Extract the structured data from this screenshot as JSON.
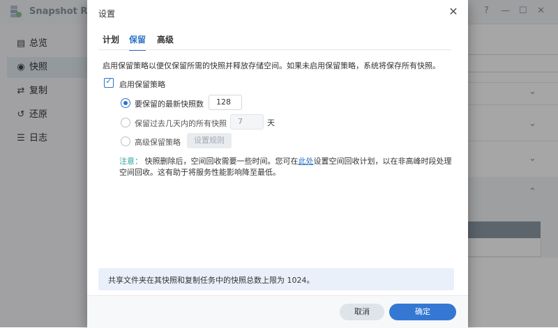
{
  "app": {
    "title": "Snapshot Replic",
    "window_controls": {
      "help": "?",
      "minimize": "—",
      "maximize": "☐",
      "close": "✕"
    }
  },
  "sidebar": {
    "items": [
      {
        "label": "总览",
        "icon": "overview-icon",
        "glyph": "▤"
      },
      {
        "label": "快照",
        "icon": "camera-icon",
        "glyph": "◉",
        "active": true
      },
      {
        "label": "复制",
        "icon": "replication-icon",
        "glyph": "⇄"
      },
      {
        "label": "还原",
        "icon": "restore-icon",
        "glyph": "↺"
      },
      {
        "label": "日志",
        "icon": "log-icon",
        "glyph": "☰"
      }
    ]
  },
  "dialog": {
    "title": "设置",
    "close_glyph": "✕",
    "tabs": [
      {
        "label": "计划"
      },
      {
        "label": "保留",
        "active": true
      },
      {
        "label": "高级"
      }
    ],
    "description": "启用保留策略以便仅保留所需的快照并释放存储空间。如果未启用保留策略，系统将保存所有快照。",
    "enable_policy": {
      "label": "启用保留策略",
      "checked": true,
      "mark": "✓"
    },
    "options": {
      "latest": {
        "label": "要保留的最新快照数",
        "value": "128",
        "selected": true
      },
      "days": {
        "label": "保留过去几天内的所有快照",
        "value": "7",
        "unit": "天",
        "selected": false
      },
      "advanced": {
        "label": "高级保留策略",
        "button_label": "设置规则",
        "selected": false
      }
    },
    "note": {
      "keyword": "注意：",
      "text_before": "快照删除后，空间回收需要一些时间。您可在",
      "link": "此处",
      "text_after": "设置空间回收计划，以在非高峰时段处理空间回收。这有助于将服务性能影响降至最低。"
    },
    "info": "共享文件夹在其快照和复制任务中的快照总数上限为 1024。",
    "buttons": {
      "cancel": "取消",
      "ok": "确定"
    }
  },
  "background": {
    "chevron_down": "⌄",
    "chevron_up": "⌃"
  },
  "colors": {
    "accent": "#2b73c8",
    "note_keyword": "#2aa199",
    "ok_button": "#3478d4"
  }
}
